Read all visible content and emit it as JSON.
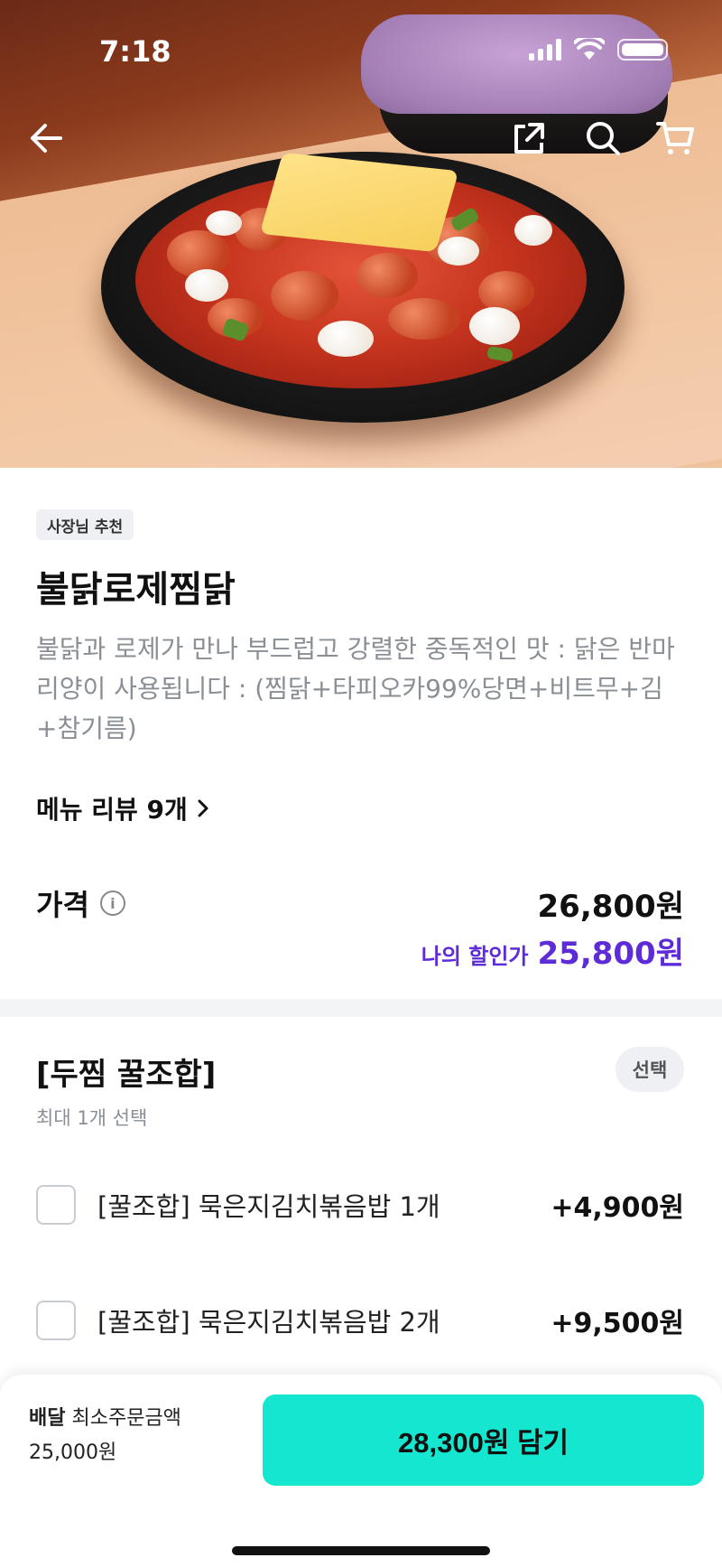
{
  "status_bar": {
    "time": "7:18"
  },
  "nav": {
    "back_icon": "arrow-left-icon",
    "share_icon": "share-icon",
    "search_icon": "search-icon",
    "cart_icon": "cart-icon"
  },
  "product": {
    "badge": "사장님 추천",
    "name": "불닭로제찜닭",
    "description": "불닭과 로제가 만나 부드럽고 강렬한 중독적인 맛 : 닭은 반마리양이 사용됩니다 : (찜닭+타피오카99%당면+비트무+김+참기름)",
    "review_link": "메뉴 리뷰 9개",
    "price_label": "가격",
    "price": "26,800원",
    "discount_label": "나의 할인가",
    "discount_price": "25,800원"
  },
  "option_group": {
    "title": "[두찜 꿀조합]",
    "subtitle": "최대 1개 선택",
    "tag": "선택",
    "options": [
      {
        "label": "[꿀조합] 묵은지김치볶음밥 1개",
        "price": "+4,900원",
        "checked": false
      },
      {
        "label": "[꿀조합] 묵은지김치볶음밥 2개",
        "price": "+9,500원",
        "checked": false
      }
    ]
  },
  "bottom_bar": {
    "delivery_label": "배달",
    "min_order_label": "최소주문금액",
    "min_order_value": "25,000원",
    "cart_button": "28,300원 담기"
  },
  "colors": {
    "accent_purple": "#5e2bd8",
    "cart_button": "#14e6cf"
  }
}
